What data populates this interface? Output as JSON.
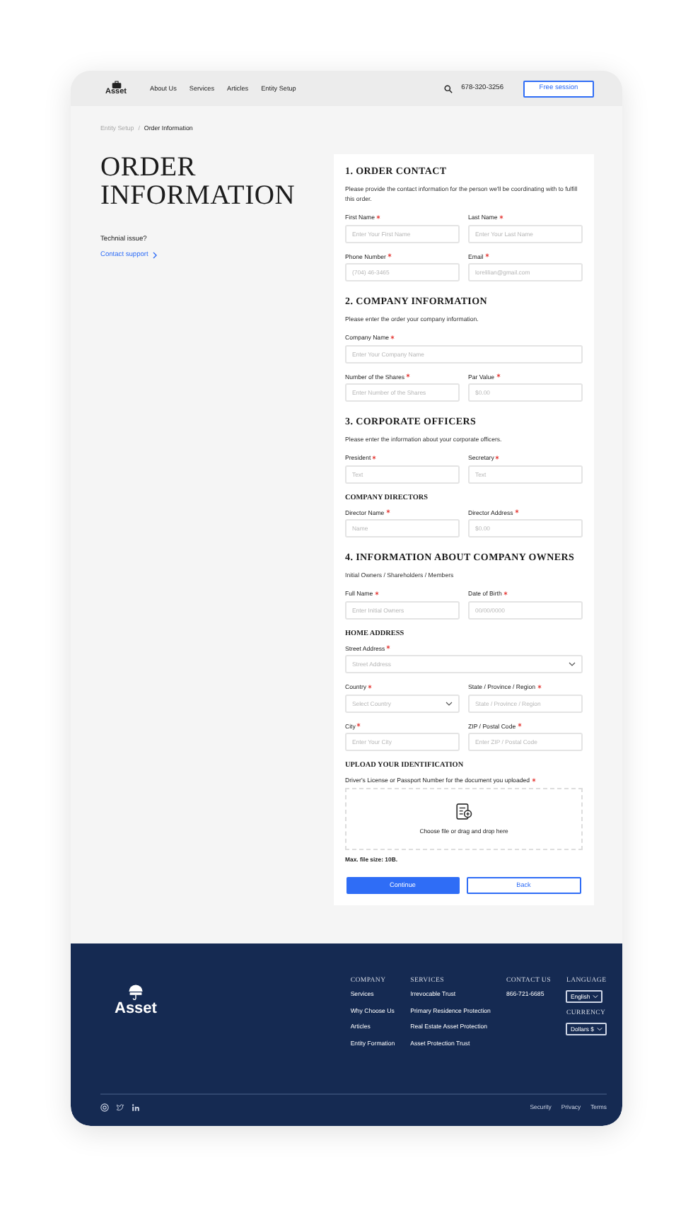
{
  "header": {
    "logo": "Asset",
    "nav": [
      {
        "label": "About Us"
      },
      {
        "label": "Services"
      },
      {
        "label": "Articles"
      },
      {
        "label": "Entity Setup"
      }
    ],
    "phone": "678-320-3256",
    "cta": "Free session"
  },
  "breadcrumb": {
    "separator": "/",
    "items": [
      {
        "label": "Entity Setup",
        "current": false
      },
      {
        "label": "Order Information",
        "current": true
      }
    ]
  },
  "page_title": "ORDER INFORMATION",
  "support": {
    "question": "Technial issue?",
    "link": "Contact support"
  },
  "form": {
    "sections": [
      {
        "title": "1. ORDER CONTACT",
        "description": "Please provide the contact information for the person we'll be coordinating with to fulfill this order.",
        "blocks": [
          {
            "kind": "row",
            "fields": [
              {
                "label": "First Name",
                "required": true,
                "placeholder": "Enter Your First Name",
                "dropdown": false
              },
              {
                "label": "Last Name",
                "required": true,
                "placeholder": "Enter Your Last Name",
                "dropdown": false
              }
            ]
          },
          {
            "kind": "row",
            "fields": [
              {
                "label": "Phone Number",
                "required": true,
                "placeholder": "(704) 46-3465",
                "dropdown": false
              },
              {
                "label": "Email",
                "required": true,
                "placeholder": "lorelilian@gmail.com",
                "dropdown": false
              }
            ]
          }
        ]
      },
      {
        "title": "2. COMPANY INFORMATION",
        "description": "Please enter the order your company information.",
        "blocks": [
          {
            "kind": "row",
            "fields": [
              {
                "label": "Company Name",
                "required": true,
                "placeholder": "Enter Your Company Name",
                "dropdown": false
              }
            ]
          },
          {
            "kind": "row",
            "fields": [
              {
                "label": "Number of the Shares",
                "required": true,
                "placeholder": "Enter Number of the Shares",
                "dropdown": false
              },
              {
                "label": "Par Value",
                "required": true,
                "placeholder": "$0.00",
                "dropdown": false
              }
            ]
          }
        ]
      },
      {
        "title": "3. CORPORATE OFFICERS",
        "description": "Please enter the information about your corporate officers.",
        "blocks": [
          {
            "kind": "row",
            "fields": [
              {
                "label": "President",
                "required": true,
                "placeholder": "Text",
                "dropdown": false
              },
              {
                "label": "Secretary",
                "required": true,
                "placeholder": "Text",
                "dropdown": false
              }
            ]
          },
          {
            "kind": "subheading",
            "text": "COMPANY DIRECTORS"
          },
          {
            "kind": "row",
            "fields": [
              {
                "label": "Director Name",
                "required": true,
                "placeholder": "Name",
                "dropdown": false
              },
              {
                "label": "Director Address",
                "required": true,
                "placeholder": "$0.00",
                "dropdown": false
              }
            ]
          }
        ]
      },
      {
        "title": "4. INFORMATION ABOUT COMPANY OWNERS",
        "description": "Initial Owners / Shareholders / Members",
        "blocks": [
          {
            "kind": "row",
            "fields": [
              {
                "label": "Full Name",
                "required": true,
                "placeholder": "Enter Initial Owners",
                "dropdown": false
              },
              {
                "label": "Date of Birth",
                "required": true,
                "placeholder": "00/00/0000",
                "dropdown": false
              }
            ]
          },
          {
            "kind": "subheading",
            "text": "HOME ADDRESS"
          },
          {
            "kind": "row",
            "fields": [
              {
                "label": "Street Address",
                "required": true,
                "placeholder": "Street Address",
                "dropdown": true
              }
            ]
          },
          {
            "kind": "row",
            "fields": [
              {
                "label": "Country",
                "required": true,
                "placeholder": "Select Country",
                "dropdown": true
              },
              {
                "label": "State / Province / Region",
                "required": true,
                "placeholder": "State / Province / Region",
                "dropdown": false
              }
            ]
          },
          {
            "kind": "row",
            "fields": [
              {
                "label": "City",
                "required": true,
                "placeholder": "Enter Your City",
                "dropdown": false
              },
              {
                "label": "ZIP / Postal Code",
                "required": true,
                "placeholder": "Enter ZIP / Postal Code",
                "dropdown": false
              }
            ]
          },
          {
            "kind": "subheading",
            "text": "UPLOAD YOUR IDENTIFICATION"
          },
          {
            "kind": "upload",
            "label": "Driver's License or Passport Number for the document you uploaded",
            "required": true,
            "hint": "Choose file or drag and drop here"
          },
          {
            "kind": "note",
            "text": "Max. file size: 10B."
          }
        ]
      }
    ],
    "buttons": [
      {
        "label": "Continue",
        "kind": "primary"
      },
      {
        "label": "Back",
        "kind": "secondary"
      }
    ]
  },
  "footer": {
    "logo": "Asset",
    "columns": [
      {
        "title": "COMPANY",
        "links": [
          "Services",
          "Why Choose Us",
          "Articles",
          "Entity Formation"
        ]
      },
      {
        "title": "SERVICES",
        "links": [
          "Irrevocable Trust",
          "Primary Residence Protection",
          "Real Estate Asset Protection",
          "Asset Protection Trust"
        ]
      },
      {
        "title": "CONTACT US",
        "links": [
          "866-721-6685"
        ]
      }
    ],
    "selects": [
      {
        "title": "LANGUAGE",
        "value": "English"
      },
      {
        "title": "CURRENCY",
        "value": "Dollars $"
      }
    ],
    "legal": [
      "Security",
      "Privacy",
      "Terms"
    ]
  }
}
